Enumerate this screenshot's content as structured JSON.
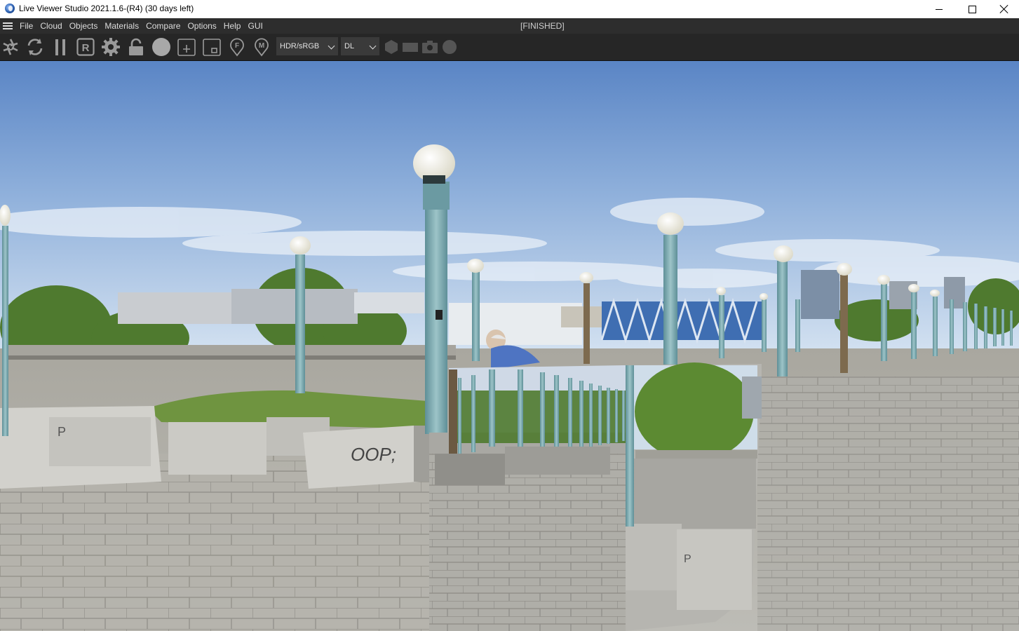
{
  "window": {
    "title": "Live Viewer Studio 2021.1.6-(R4) (30 days left)",
    "controls": [
      "minimize",
      "maximize",
      "close"
    ]
  },
  "menubar": {
    "items": [
      "File",
      "Cloud",
      "Objects",
      "Materials",
      "Compare",
      "Options",
      "Help",
      "GUI"
    ],
    "status": "[FINISHED]"
  },
  "toolbar": {
    "buttons": [
      "aperture-icon",
      "refresh-icon",
      "pause-icon",
      "region-render-icon",
      "settings-gear-icon",
      "lock-icon",
      "material-sphere-icon",
      "add-region-icon",
      "region-minus-icon",
      "focus-pin-icon",
      "material-pin-icon"
    ],
    "colorspace": "HDR/sRGB",
    "render_mode": "DL",
    "disabled_buttons": [
      "hexagon-icon",
      "rectangle-icon",
      "camera-icon",
      "circle-icon"
    ]
  },
  "viewport": {
    "content": "rendered scene",
    "colors": {
      "sky_top": "#5b86c6",
      "sky_bottom": "#cfdff0",
      "lamp_pole": "#79a6ad",
      "ground": "#a6a6a2",
      "grass": "#6f8f3a"
    }
  }
}
